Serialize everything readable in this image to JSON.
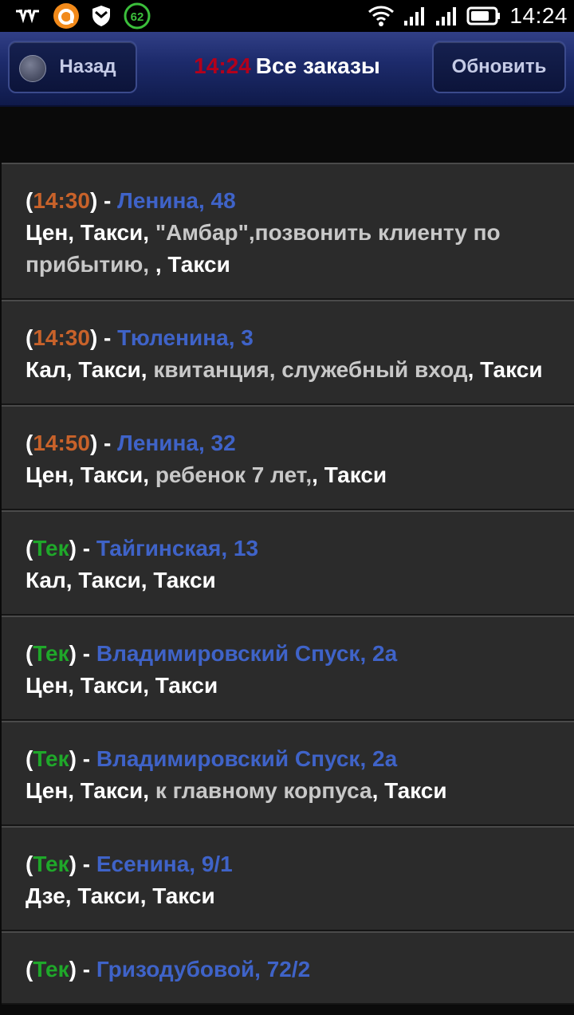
{
  "status_bar": {
    "time": "14:24",
    "battery_level": "62",
    "icons": [
      "tele2-icon",
      "orange-circle-app-icon",
      "shield-icon",
      "battery-saver-icon",
      "wifi-icon",
      "signal-icon-1",
      "signal-icon-2",
      "battery-icon"
    ]
  },
  "header": {
    "back_label": "Назад",
    "clock": "14:24",
    "title": "Все заказы",
    "refresh_label": "Обновить"
  },
  "colors": {
    "time_scheduled": "#c8622a",
    "time_current": "#1fa82a",
    "address": "#3f63c8",
    "clock": "#b3001b"
  },
  "orders": [
    {
      "time": "14:30",
      "status": "scheduled",
      "address": "Ленина, 48",
      "prefix": "Цен, Такси, ",
      "note": "\"Амбар\",позвонить клиенту по прибытию, ",
      "suffix": ", Такси"
    },
    {
      "time": "14:30",
      "status": "scheduled",
      "address": "Тюленина, 3",
      "prefix": "Кал, Такси, ",
      "note": "квитанция, служебный вход",
      "suffix": ", Такси"
    },
    {
      "time": "14:50",
      "status": "scheduled",
      "address": "Ленина, 32",
      "prefix": "Цен, Такси, ",
      "note": "ребенок 7 лет,",
      "suffix": ", Такси"
    },
    {
      "time": "Тек",
      "status": "current",
      "address": "Тайгинская, 13",
      "prefix": "Кал, Такси, Такси",
      "note": "",
      "suffix": ""
    },
    {
      "time": "Тек",
      "status": "current",
      "address": "Владимировский Спуск, 2а",
      "prefix": "Цен, Такси, Такси",
      "note": "",
      "suffix": ""
    },
    {
      "time": "Тек",
      "status": "current",
      "address": "Владимировский Спуск, 2а",
      "prefix": "Цен, Такси, ",
      "note": "к главному корпуса",
      "suffix": ", Такси"
    },
    {
      "time": "Тек",
      "status": "current",
      "address": "Есенина, 9/1",
      "prefix": "Дзе, Такси, Такси",
      "note": "",
      "suffix": ""
    },
    {
      "time": "Тек",
      "status": "current",
      "address": "Гризодубовой, 72/2",
      "prefix": "",
      "note": "",
      "suffix": ""
    }
  ]
}
